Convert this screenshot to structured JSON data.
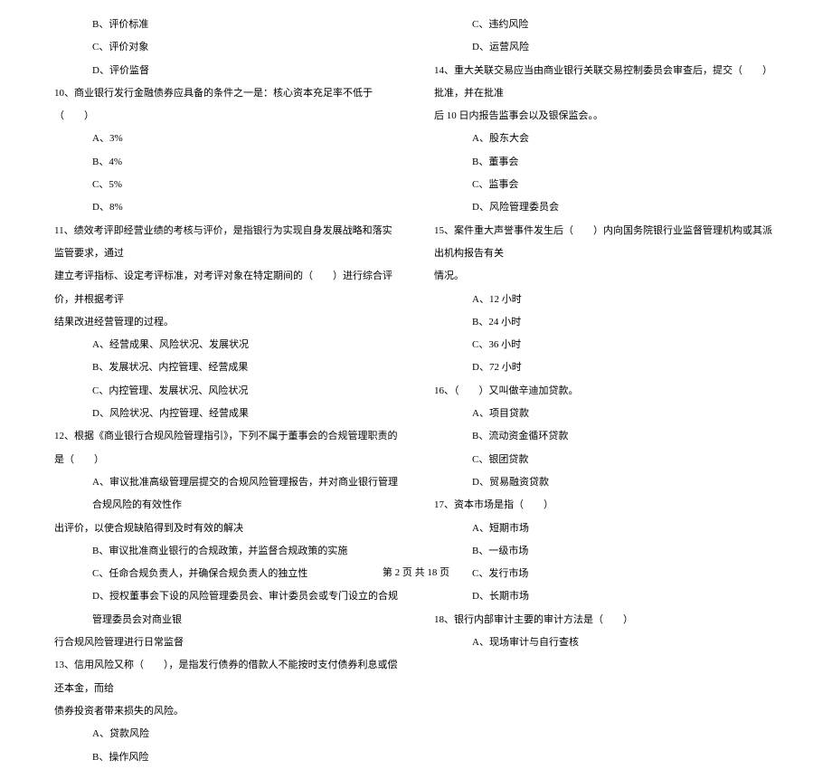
{
  "left": {
    "l1": "B、评价标准",
    "l2": "C、评价对象",
    "l3": "D、评价监督",
    "q10": "10、商业银行发行金融债券应具备的条件之一是：核心资本充足率不低于（　　）",
    "q10a": "A、3%",
    "q10b": "B、4%",
    "q10c": "C、5%",
    "q10d": "D、8%",
    "q11_1": "11、绩效考评即经营业绩的考核与评价，是指银行为实现自身发展战略和落实监管要求，通过",
    "q11_2": "建立考评指标、设定考评标准，对考评对象在特定期间的（　　）进行综合评价，并根据考评",
    "q11_3": "结果改进经营管理的过程。",
    "q11a": "A、经营成果、风险状况、发展状况",
    "q11b": "B、发展状况、内控管理、经营成果",
    "q11c": "C、内控管理、发展状况、风险状况",
    "q11d": "D、风险状况、内控管理、经营成果",
    "q12_1": "12、根据《商业银行合规风险管理指引》，下列不属于董事会的合规管理职责的是（　　）",
    "q12a_1": "A、审议批准高级管理层提交的合规风险管理报告，并对商业银行管理合规风险的有效性作",
    "q12a_2": "出评价，以使合规缺陷得到及时有效的解决",
    "q12b": "B、审议批准商业银行的合规政策，并监督合规政策的实施",
    "q12c": "C、任命合规负责人，并确保合规负责人的独立性",
    "q12d_1": "D、授权董事会下设的风险管理委员会、审计委员会或专门设立的合规管理委员会对商业银",
    "q12d_2": "行合规风险管理进行日常监督",
    "q13_1": "13、信用风险又称（　　），是指发行债券的借款人不能按时支付债券利息或偿还本金，而给",
    "q13_2": "债券投资者带来损失的风险。",
    "q13a": "A、贷款风险",
    "q13b": "B、操作风险"
  },
  "right": {
    "r1": "C、违约风险",
    "r2": "D、运营风险",
    "q14_1": "14、重大关联交易应当由商业银行关联交易控制委员会审查后，提交（　　）批准，并在批准",
    "q14_2": "后 10 日内报告监事会以及银保监会。。",
    "q14a": "A、股东大会",
    "q14b": "B、董事会",
    "q14c": "C、监事会",
    "q14d": "D、风险管理委员会",
    "q15_1": "15、案件重大声誉事件发生后（　　）内向国务院银行业监督管理机构或其派出机构报告有关",
    "q15_2": "情况。",
    "q15a": "A、12 小时",
    "q15b": "B、24 小时",
    "q15c": "C、36 小时",
    "q15d": "D、72 小时",
    "q16": "16、（　　）又叫做辛迪加贷款。",
    "q16a": "A、项目贷款",
    "q16b": "B、流动资金循环贷款",
    "q16c": "C、银团贷款",
    "q16d": "D、贸易融资贷款",
    "q17": "17、资本市场是指（　　）",
    "q17a": "A、短期市场",
    "q17b": "B、一级市场",
    "q17c": "C、发行市场",
    "q17d": "D、长期市场",
    "q18": "18、银行内部审计主要的审计方法是（　　）",
    "q18a": "A、现场审计与自行查核"
  },
  "footer": "第 2 页 共 18 页"
}
